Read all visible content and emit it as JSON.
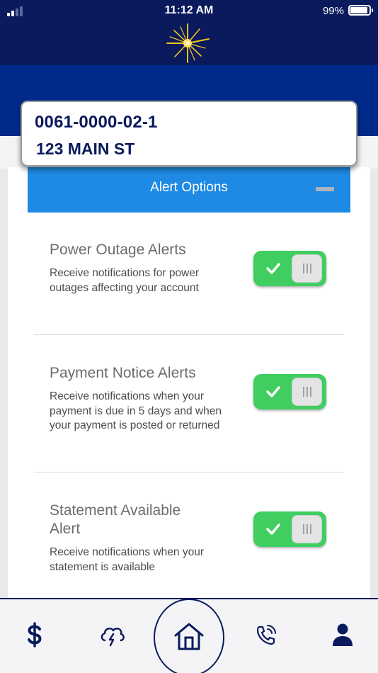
{
  "status_bar": {
    "time": "11:12 AM",
    "battery": "99%"
  },
  "account": {
    "number": "0061-0000-02-1",
    "address": "123 MAIN ST"
  },
  "section": {
    "title": "Alert Options"
  },
  "alerts": [
    {
      "title": "Power Outage Alerts",
      "description": "Receive notifications for power outages affecting your account",
      "enabled": true
    },
    {
      "title": "Payment Notice Alerts",
      "description": "Receive notifications when your payment is due in 5 days and when your payment is posted or returned",
      "enabled": true
    },
    {
      "title": "Statement Available Alert",
      "description": "Receive notifications when your statement is available",
      "enabled": true
    }
  ],
  "tabs": [
    "dollar-icon",
    "storm-icon",
    "home-icon",
    "phone-icon",
    "person-icon"
  ],
  "colors": {
    "navy": "#0a1a5c",
    "header_blue": "#002a8a",
    "section_blue": "#1e8ae3",
    "toggle_green": "#3fce5f"
  }
}
